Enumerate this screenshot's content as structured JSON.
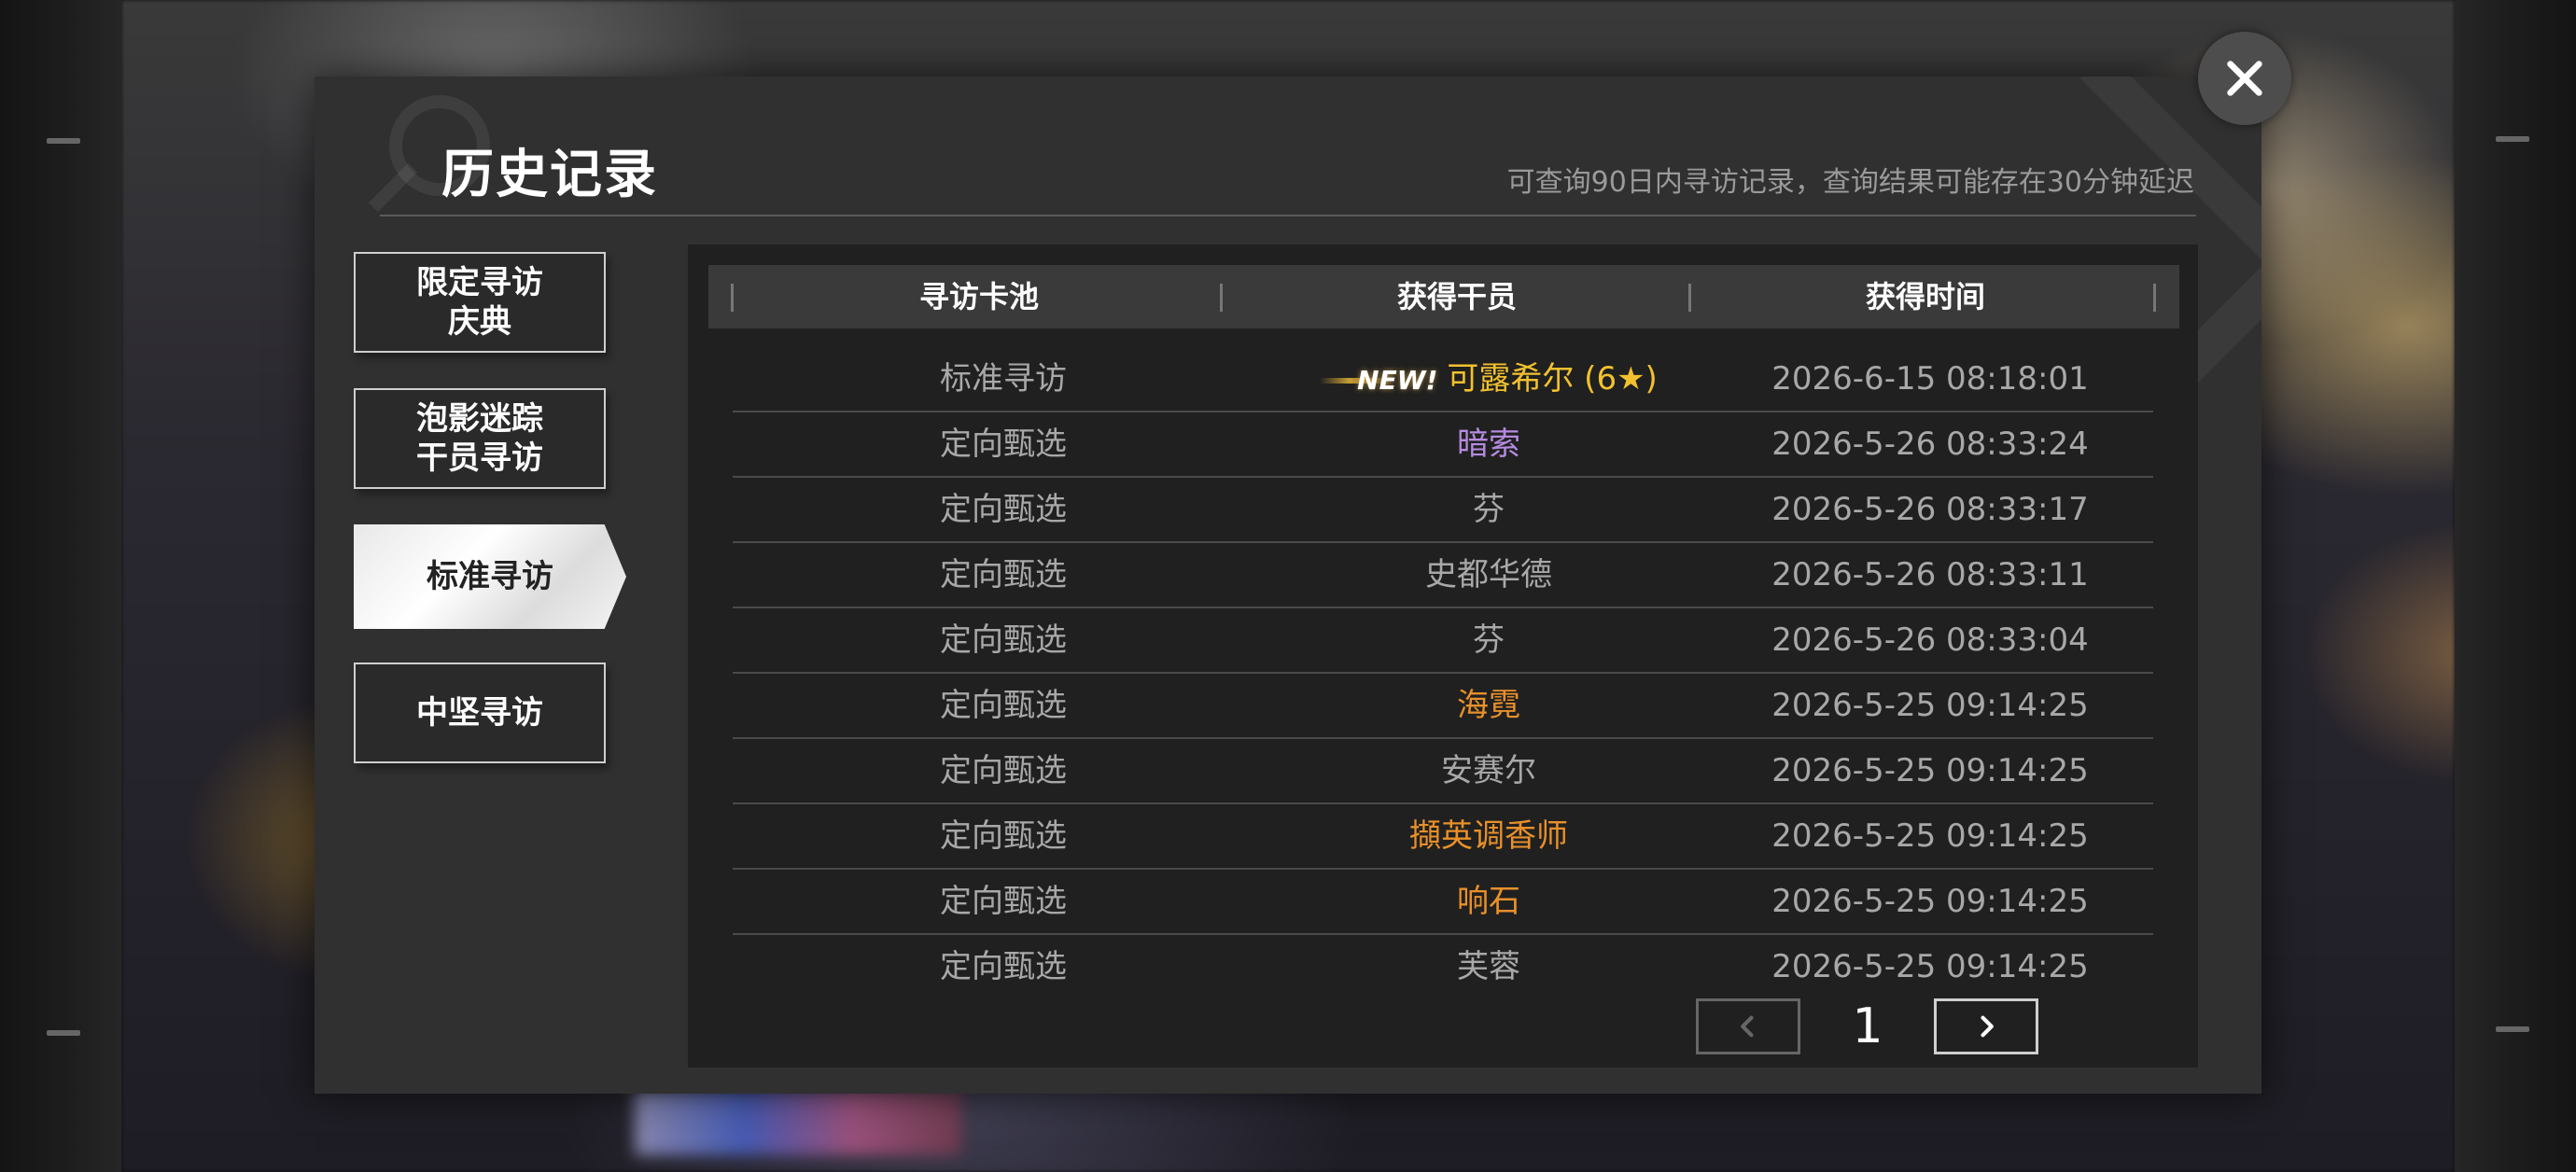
{
  "dialog": {
    "title": "历史记录",
    "hint": "可查询90日内寻访记录，查询结果可能存在30分钟延迟"
  },
  "tabs": [
    {
      "label": "限定寻访\n庆典",
      "active": false
    },
    {
      "label": "泡影迷踪\n干员寻访",
      "active": false
    },
    {
      "label": "标准寻访",
      "active": true
    },
    {
      "label": "中坚寻访",
      "active": false
    }
  ],
  "table": {
    "headers": [
      "寻访卡池",
      "获得干员",
      "获得时间"
    ],
    "new_badge": "NEW!",
    "rows": [
      {
        "pool": "标准寻访",
        "operator": "可露希尔 (6★)",
        "time": "2026-6-15 08:18:01",
        "color": "#f2c12e",
        "is_new": true
      },
      {
        "pool": "定向甄选",
        "operator": "暗索",
        "time": "2026-5-26 08:33:24",
        "color": "#b58be0",
        "is_new": false
      },
      {
        "pool": "定向甄选",
        "operator": "芬",
        "time": "2026-5-26 08:33:17",
        "color": "#a8a8a8",
        "is_new": false
      },
      {
        "pool": "定向甄选",
        "operator": "史都华德",
        "time": "2026-5-26 08:33:11",
        "color": "#a8a8a8",
        "is_new": false
      },
      {
        "pool": "定向甄选",
        "operator": "芬",
        "time": "2026-5-26 08:33:04",
        "color": "#a8a8a8",
        "is_new": false
      },
      {
        "pool": "定向甄选",
        "operator": "海霓",
        "time": "2026-5-25 09:14:25",
        "color": "#e8902a",
        "is_new": false
      },
      {
        "pool": "定向甄选",
        "operator": "安赛尔",
        "time": "2026-5-25 09:14:25",
        "color": "#a8a8a8",
        "is_new": false
      },
      {
        "pool": "定向甄选",
        "operator": "擷英调香师",
        "time": "2026-5-25 09:14:25",
        "color": "#e8902a",
        "is_new": false
      },
      {
        "pool": "定向甄选",
        "operator": "响石",
        "time": "2026-5-25 09:14:25",
        "color": "#e8902a",
        "is_new": false
      },
      {
        "pool": "定向甄选",
        "operator": "芙蓉",
        "time": "2026-5-25 09:14:25",
        "color": "#a8a8a8",
        "is_new": false
      }
    ]
  },
  "pagination": {
    "current_page": "1"
  },
  "icons": {
    "close": "close-icon",
    "prev": "chevron-left-icon",
    "next": "chevron-right-icon"
  }
}
